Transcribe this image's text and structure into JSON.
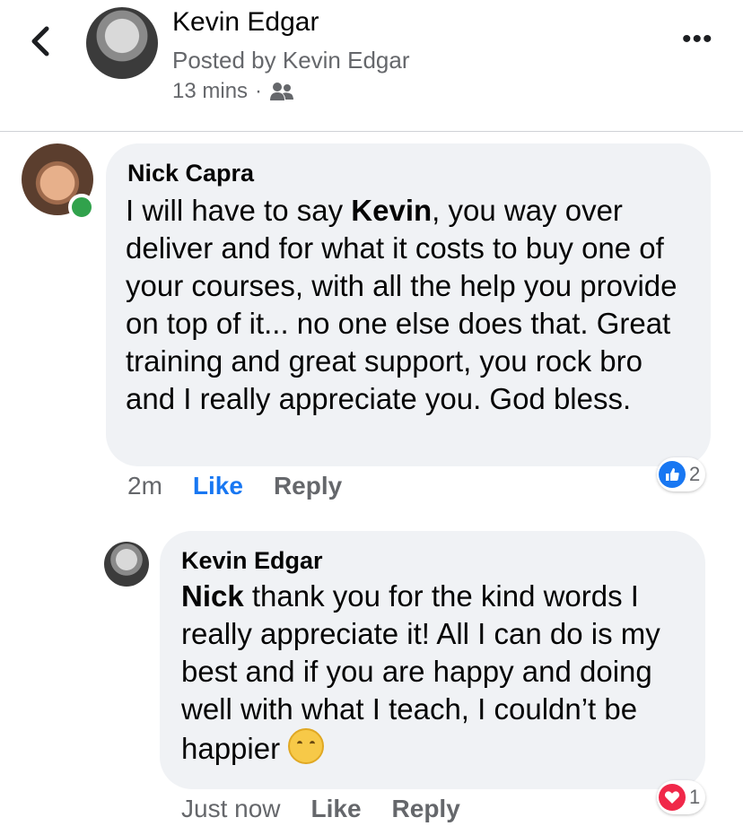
{
  "header": {
    "name": "Kevin Edgar",
    "subtitle": "Posted by Kevin Edgar",
    "time": "13 mins",
    "separator": "·",
    "more_label": "•••"
  },
  "comments": [
    {
      "author": "Nick Capra",
      "text_before": "I will have to say ",
      "mention": "Kevin",
      "text_after": ", you way over deliver and for what it costs to buy one of your courses, with all the help you provide on top of it... no one else does that. Great training and great support, you rock bro and I really appreciate you. God bless.",
      "time": "2m",
      "like_label": "Like",
      "reply_label": "Reply",
      "reaction_count": "2",
      "reaction_icon": "like-icon",
      "online": true
    },
    {
      "author": "Kevin Edgar",
      "mention": "Nick",
      "text_after": " thank you for the kind words I really appreciate it! All I can do is my best and if you are happy and doing well with what I teach, I couldn’t be happier",
      "time": "Just now",
      "like_label": "Like",
      "reply_label": "Reply",
      "reaction_count": "1",
      "reaction_icon": "heart-icon"
    }
  ],
  "colors": {
    "accent": "#1877f2",
    "online": "#31a24c",
    "heart": "#f02849",
    "bubble": "#f0f2f5"
  }
}
